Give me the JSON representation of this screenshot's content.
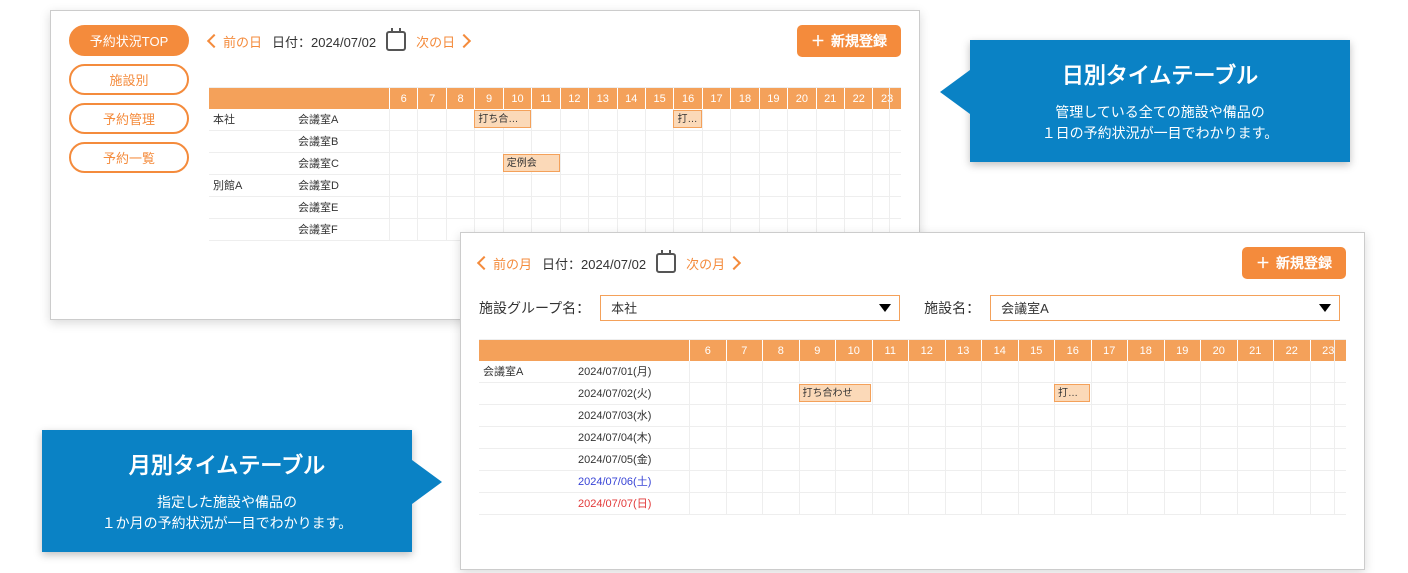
{
  "colors": {
    "accent": "#f48b3c",
    "callout": "#0a82c5"
  },
  "sidebar": {
    "items": [
      {
        "label": "予約状況TOP",
        "active": true
      },
      {
        "label": "施設別",
        "active": false
      },
      {
        "label": "予約管理",
        "active": false
      },
      {
        "label": "予約一覧",
        "active": false
      }
    ]
  },
  "hours": [
    "6",
    "7",
    "8",
    "9",
    "10",
    "11",
    "12",
    "13",
    "14",
    "15",
    "16",
    "17",
    "18",
    "19",
    "20",
    "21",
    "22",
    "23"
  ],
  "daily": {
    "nav": {
      "prev": "前の日",
      "next": "次の日",
      "date_label": "日付：",
      "date_value": "2024/07/02"
    },
    "new_button": "新規登録",
    "groups": [
      {
        "name": "本社",
        "rooms": [
          {
            "name": "会議室A",
            "bookings": [
              {
                "label": "打ち合わせ",
                "start": 9,
                "end": 11
              },
              {
                "label": "打ち…",
                "start": 16,
                "end": 17
              }
            ]
          },
          {
            "name": "会議室B",
            "bookings": []
          },
          {
            "name": "会議室C",
            "bookings": [
              {
                "label": "定例会",
                "start": 10,
                "end": 12
              }
            ]
          }
        ]
      },
      {
        "name": "別館A",
        "rooms": [
          {
            "name": "会議室D",
            "bookings": []
          },
          {
            "name": "会議室E",
            "bookings": []
          },
          {
            "name": "会議室F",
            "bookings": []
          }
        ]
      }
    ]
  },
  "monthly": {
    "nav": {
      "prev": "前の月",
      "next": "次の月",
      "date_label": "日付：",
      "date_value": "2024/07/02"
    },
    "new_button": "新規登録",
    "group_label": "施設グループ名：",
    "group_value": "本社",
    "facility_label": "施設名：",
    "facility_value": "会議室A",
    "room": "会議室A",
    "days": [
      {
        "label": "2024/07/01(月)",
        "dow": "wd",
        "bookings": []
      },
      {
        "label": "2024/07/02(火)",
        "dow": "wd",
        "bookings": [
          {
            "label": "打ち合わせ",
            "start": 9,
            "end": 11
          },
          {
            "label": "打ち…",
            "start": 16,
            "end": 17
          }
        ]
      },
      {
        "label": "2024/07/03(水)",
        "dow": "wd",
        "bookings": []
      },
      {
        "label": "2024/07/04(木)",
        "dow": "wd",
        "bookings": []
      },
      {
        "label": "2024/07/05(金)",
        "dow": "wd",
        "bookings": []
      },
      {
        "label": "2024/07/06(土)",
        "dow": "sat",
        "bookings": []
      },
      {
        "label": "2024/07/07(日)",
        "dow": "sun",
        "bookings": []
      }
    ]
  },
  "callouts": {
    "daily": {
      "title": "日別タイムテーブル",
      "line1": "管理している全ての施設や備品の",
      "line2": "１日の予約状況が一目でわかります。"
    },
    "monthly": {
      "title": "月別タイムテーブル",
      "line1": "指定した施設や備品の",
      "line2": "１か月の予約状況が一目でわかります。"
    }
  }
}
